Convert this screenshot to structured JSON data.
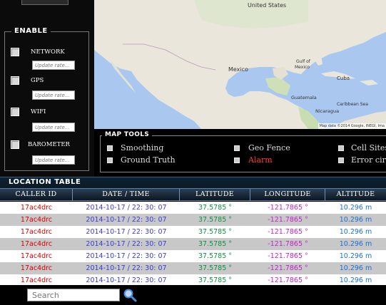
{
  "enable": {
    "title": "ENABLE",
    "sensors": [
      {
        "label": "NETWORK",
        "placeholder": "Update rate..."
      },
      {
        "label": "GPS",
        "placeholder": "Update rate..."
      },
      {
        "label": "WIFI",
        "placeholder": "Update rate..."
      },
      {
        "label": "BAROMETER",
        "placeholder": "Update rate..."
      }
    ]
  },
  "map": {
    "labels": {
      "united_states": "United States",
      "mexico": "Mexico",
      "gulf_of_mexico": "Gulf of\nMexico",
      "cuba": "Cuba",
      "guatemala": "Guatemala",
      "nicaragua": "Nicaragua",
      "caribbean_sea": "Caribbean Sea"
    },
    "attribution": "Map data ©2014 Google, INEGI, Ima"
  },
  "map_tools": {
    "title": "MAP TOOLS",
    "items": [
      {
        "label": "Smoothing"
      },
      {
        "label": "Ground Truth"
      },
      {
        "label": "Geo Fence"
      },
      {
        "label": "Alarm"
      },
      {
        "label": "Cell Sites/"
      },
      {
        "label": "Error circl"
      }
    ]
  },
  "location_table": {
    "title": "LOCATION TABLE",
    "columns": [
      "CALLER ID",
      "DATE / TIME",
      "LATITUDE",
      "LONGITUDE",
      "ALTITUDE"
    ],
    "rows": [
      [
        "17ac4drc",
        "2014-10-17 / 22: 30: 07",
        "37.5785 °",
        "-121.7865 °",
        "10.296 m"
      ],
      [
        "17ac4drc",
        "2014-10-17 / 22: 30: 07",
        "37.5785 °",
        "-121.7865 °",
        "10.296 m"
      ],
      [
        "17ac4drc",
        "2014-10-17 / 22: 30: 07",
        "37.5785 °",
        "-121.7865 °",
        "10.296 m"
      ],
      [
        "17ac4drc",
        "2014-10-17 / 22: 30: 07",
        "37.5785 °",
        "-121.7865 °",
        "10.296 m"
      ],
      [
        "17ac4drc",
        "2014-10-17 / 22: 30: 07",
        "37.5785 °",
        "-121.7865 °",
        "10.296 m"
      ],
      [
        "17ac4drc",
        "2014-10-17 / 22: 30: 07",
        "37.5785 °",
        "-121.7865 °",
        "10.296 m"
      ],
      [
        "17ac4drc",
        "2014-10-17 / 22: 30: 07",
        "37.5785 °",
        "-121.7865 °",
        "10.296 m"
      ]
    ]
  },
  "search": {
    "placeholder": "Search",
    "icon": "search-icon"
  },
  "colors": {
    "caller_id": "#d80000",
    "datetime": "#3a3ad8",
    "latitude": "#119044",
    "longitude": "#c224c8",
    "altitude": "#1b6fd6",
    "alarm": "#ff3a3a"
  }
}
